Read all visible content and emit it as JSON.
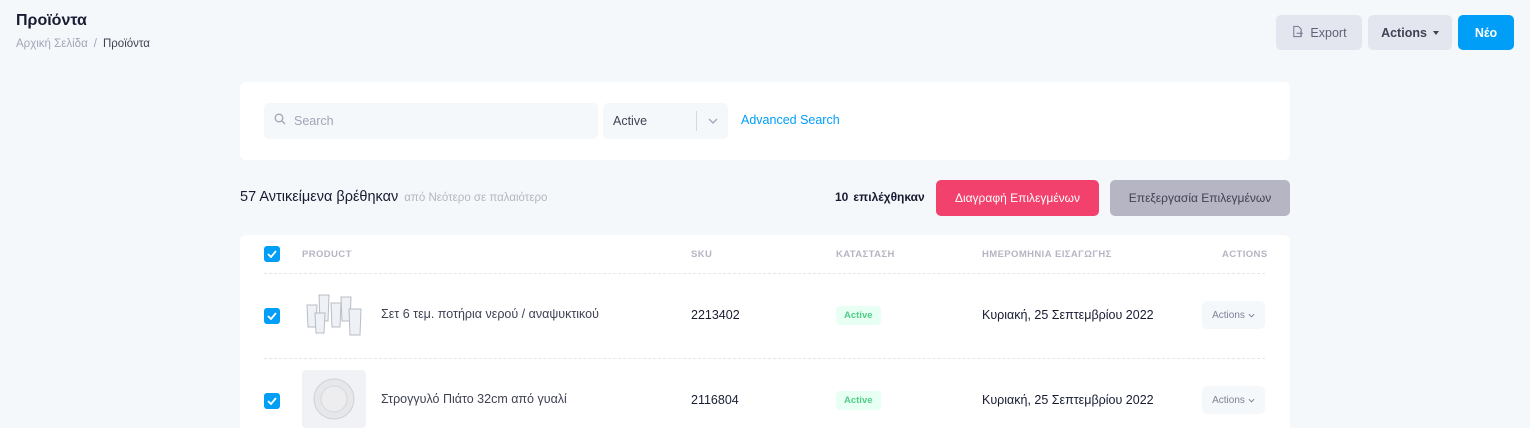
{
  "header": {
    "title": "Προϊόντα",
    "breadcrumb": {
      "home": "Αρχική Σελίδα",
      "separator": "/",
      "current": "Προϊόντα"
    },
    "export_label": "Export",
    "actions_label": "Actions",
    "new_label": "Νέο"
  },
  "filters": {
    "search_placeholder": "Search",
    "status_value": "Active",
    "advanced_search_label": "Advanced Search"
  },
  "results": {
    "count_text": "57 Αντικείμενα βρέθηκαν",
    "sort_text": "από Νεότερο σε παλαιότερο",
    "selected_count": "10",
    "selected_label": "επιλέχθηκαν",
    "delete_selected_label": "Διαγραφή Επιλεγμένων",
    "edit_selected_label": "Επεξεργασία Επιλεγμένων"
  },
  "table": {
    "columns": [
      "PRODUCT",
      "SKU",
      "ΚΑΤΑΣΤΑΣΗ",
      "ΗΜΕΡΟΜΗΝΙΑ ΕΙΣΑΓΩΓΗΣ",
      "ACTIONS"
    ],
    "select_all_checked": true,
    "rows": [
      {
        "name": "Σετ 6 τεμ. ποτήρια νερού / αναψυκτικού",
        "sku": "2213402",
        "status": "Active",
        "date": "Κυριακή, 25 Σεπτεμβρίου 2022",
        "actions_label": "Actions",
        "checked": true,
        "thumb_icon": "glasses-image"
      },
      {
        "name": "Στρογγυλό Πιάτο 32cm από γυαλί",
        "sku": "2116804",
        "status": "Active",
        "date": "Κυριακή, 25 Σεπτεμβρίου 2022",
        "actions_label": "Actions",
        "checked": true,
        "thumb_icon": "plate-image"
      }
    ]
  },
  "colors": {
    "primary": "#009ef7",
    "danger": "#f1416c",
    "success": "#50cd89",
    "success_light": "#e8fff3",
    "background": "#f5f8fa"
  }
}
